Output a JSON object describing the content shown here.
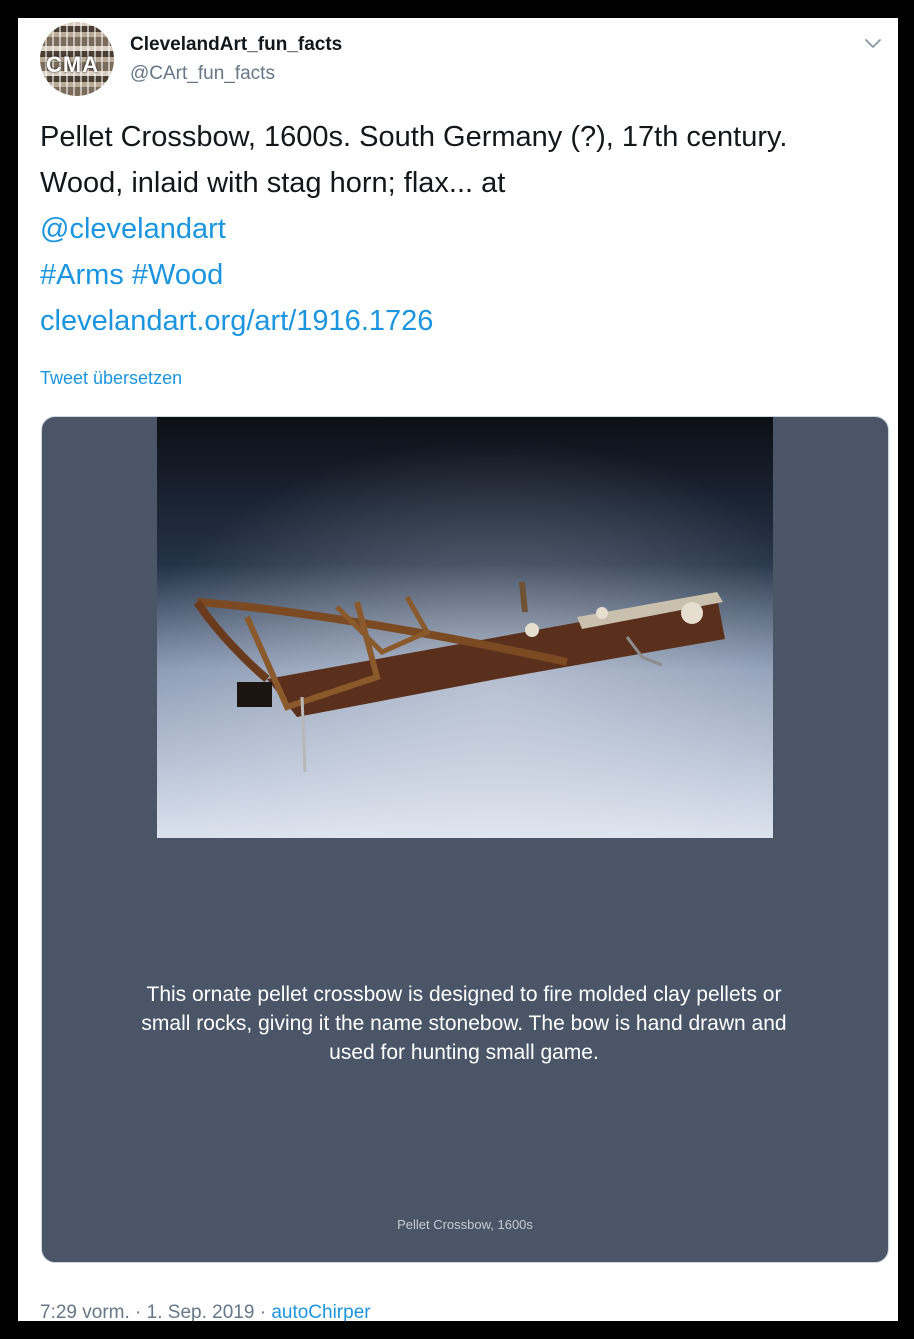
{
  "author": {
    "display_name": "ClevelandArt_fun_facts",
    "handle": "@CArt_fun_facts",
    "avatar_text": "CMA"
  },
  "tweet": {
    "text_line1": "Pellet Crossbow, 1600s. South Germany (?), 17th century. Wood, inlaid with stag horn; flax... at",
    "mention": "@clevelandart",
    "hashtag1": "#Arms",
    "hashtag2": "#Wood",
    "link": "clevelandart.org/art/1916.1726",
    "translate_label": "Tweet übersetzen"
  },
  "media": {
    "caption": "This ornate pellet crossbow is designed to fire molded clay pellets or small rocks, giving it the name stonebow. The bow is hand drawn and used for hunting small game.",
    "small_caption": "Pellet Crossbow, 1600s"
  },
  "meta": {
    "time": "7:29 vorm.",
    "sep1": "·",
    "date": "1. Sep. 2019",
    "sep2": "·",
    "source": "autoChirper"
  },
  "icons": {
    "menu": "chevron-down-icon"
  },
  "colors": {
    "link": "#1b95e0",
    "media_bg": "#4a5568",
    "text": "#14171a",
    "muted": "#657786"
  }
}
